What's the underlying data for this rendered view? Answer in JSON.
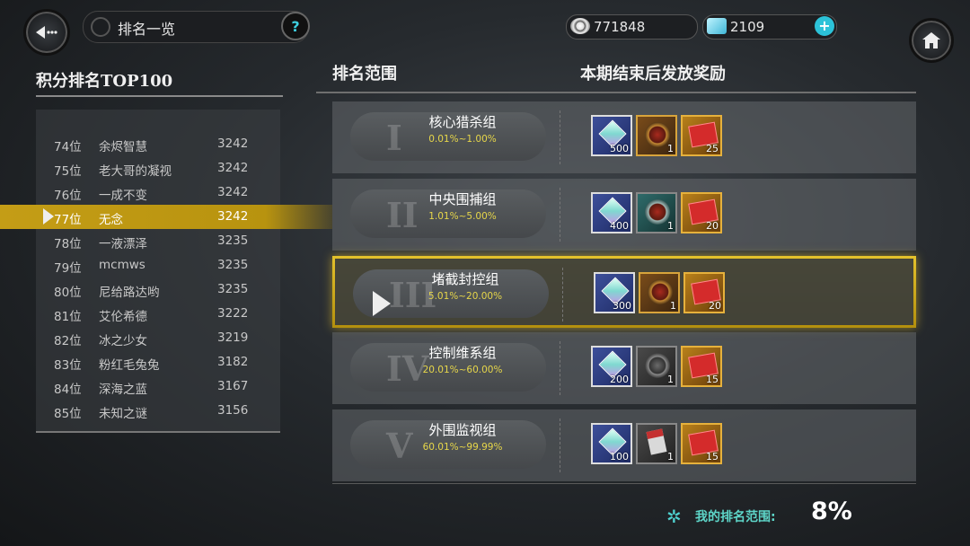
{
  "header": {
    "title": "排名一览",
    "help_label": "?",
    "coins": "771848",
    "gems": "2109",
    "plus_label": "+"
  },
  "leaderboard": {
    "title": "积分排名TOP100",
    "rows": [
      {
        "rank": "74位",
        "name": "余烬智慧",
        "score": "3242"
      },
      {
        "rank": "75位",
        "name": "老大哥的凝视",
        "score": "3242"
      },
      {
        "rank": "76位",
        "name": "一成不变",
        "score": "3242"
      },
      {
        "rank": "77位",
        "name": "无念",
        "score": "3242",
        "highlight": true
      },
      {
        "rank": "78位",
        "name": "一液漂泽",
        "score": "3235"
      },
      {
        "rank": "79位",
        "name": "mcmws",
        "score": "3235"
      },
      {
        "rank": "80位",
        "name": "尼给路达哟",
        "score": "3235"
      },
      {
        "rank": "81位",
        "name": "艾伦希德",
        "score": "3222"
      },
      {
        "rank": "82位",
        "name": "冰之少女",
        "score": "3219"
      },
      {
        "rank": "83位",
        "name": "粉红毛兔兔",
        "score": "3182"
      },
      {
        "rank": "84位",
        "name": "深海之蓝",
        "score": "3167"
      },
      {
        "rank": "85位",
        "name": "未知之谜",
        "score": "3156"
      }
    ]
  },
  "rewards": {
    "range_header": "排名范围",
    "reward_header": "本期结束后发放奖励",
    "tiers": [
      {
        "roman": "I",
        "name": "核心猎杀组",
        "range": "0.01%~1.00%",
        "items": [
          {
            "type": "gem",
            "qty": "500"
          },
          {
            "type": "medal",
            "qty": "1"
          },
          {
            "type": "ticket",
            "qty": "25"
          }
        ]
      },
      {
        "roman": "II",
        "name": "中央围捕组",
        "range": "1.01%~5.00%",
        "items": [
          {
            "type": "gem",
            "qty": "400"
          },
          {
            "type": "medal-blue",
            "qty": "1"
          },
          {
            "type": "ticket",
            "qty": "20"
          }
        ]
      },
      {
        "roman": "III",
        "name": "堵截封控组",
        "range": "5.01%~20.00%",
        "highlight": true,
        "items": [
          {
            "type": "gem",
            "qty": "300"
          },
          {
            "type": "medal",
            "qty": "1"
          },
          {
            "type": "ticket",
            "qty": "20"
          }
        ]
      },
      {
        "roman": "IV",
        "name": "控制维系组",
        "range": "20.01%~60.00%",
        "items": [
          {
            "type": "gem",
            "qty": "200"
          },
          {
            "type": "medal-dark",
            "qty": "1"
          },
          {
            "type": "ticket",
            "qty": "15"
          }
        ]
      },
      {
        "roman": "V",
        "name": "外围监视组",
        "range": "60.01%~99.99%",
        "items": [
          {
            "type": "gem",
            "qty": "100"
          },
          {
            "type": "card-dark",
            "qty": "1"
          },
          {
            "type": "ticket",
            "qty": "15"
          }
        ]
      }
    ]
  },
  "my_rank": {
    "label": "我的排名范围:",
    "value": "8%"
  },
  "colors": {
    "highlight_gold": "#c49d16",
    "accent_cyan": "#2cc2d8",
    "range_text": "#e6d64a"
  }
}
